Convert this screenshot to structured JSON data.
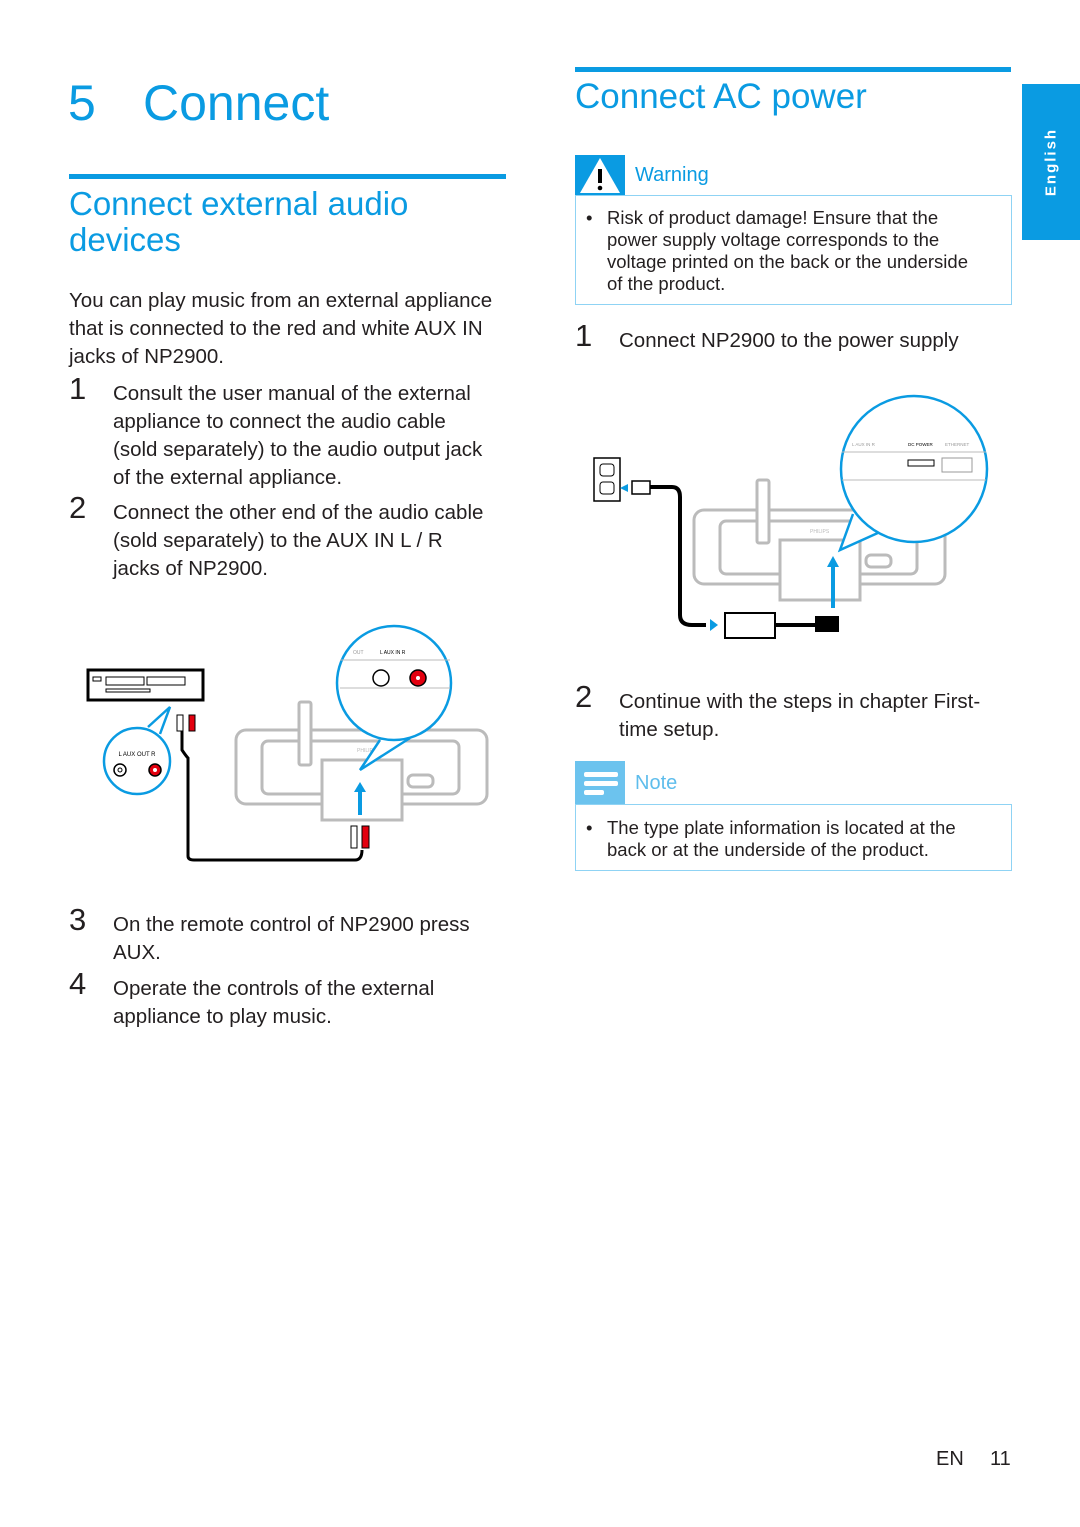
{
  "colors": {
    "accent": "#0a9be2",
    "box_border": "#8fd3f4",
    "plug_red": "#e3000f"
  },
  "chapter": {
    "number": "5",
    "title": "Connect"
  },
  "left": {
    "section_title_line1": "Connect external audio",
    "section_title_line2": "devices",
    "intro_lines": [
      "You can play music from an external appliance",
      "that is connected to the red and white AUX IN",
      "jacks of NP2900."
    ],
    "steps": [
      {
        "number": "1",
        "lines": [
          "Consult the user manual of the external",
          "appliance to connect the audio cable",
          "(sold separately) to the audio output jack",
          "of the external appliance."
        ]
      },
      {
        "number": "2",
        "lines": [
          "Connect the other end of the audio cable",
          "(sold separately) to the AUX IN L / R",
          "jacks of NP2900."
        ]
      },
      {
        "number": "3",
        "lines": [
          "On the remote control of NP2900 press",
          "AUX."
        ]
      },
      {
        "number": "4",
        "lines": [
          "Operate the controls of the external",
          "appliance to play music."
        ]
      }
    ],
    "figure": {
      "aux_out_label": "L  AUX OUT  R",
      "aux_in_label": "L    AUX IN    R",
      "out_label": "OUT",
      "brand": "PHILIPS"
    }
  },
  "right": {
    "section_title": "Connect AC power",
    "warning": {
      "icon": "warning-triangle-icon",
      "label": "Warning",
      "lines": [
        "Risk of product damage! Ensure that the",
        "power supply voltage corresponds to the",
        "voltage printed on the back or the underside",
        "of the product."
      ]
    },
    "steps": [
      {
        "number": "1",
        "lines": [
          "Connect NP2900 to the power supply"
        ]
      },
      {
        "number": "2",
        "lines": [
          "Continue with the steps in chapter First-",
          "time setup."
        ]
      }
    ],
    "figure": {
      "aux_in_label": "L    AUX IN    R",
      "dc_power_label": "DC POWER",
      "ethernet_label": "ETHERNET",
      "brand": "PHILIPS"
    },
    "note": {
      "icon": "note-lines-icon",
      "label": "Note",
      "lines": [
        "The type plate information is located at the",
        "back or at the underside of the product."
      ]
    }
  },
  "side_tab": {
    "label": "English"
  },
  "footer": {
    "lang": "EN",
    "page": "11"
  }
}
